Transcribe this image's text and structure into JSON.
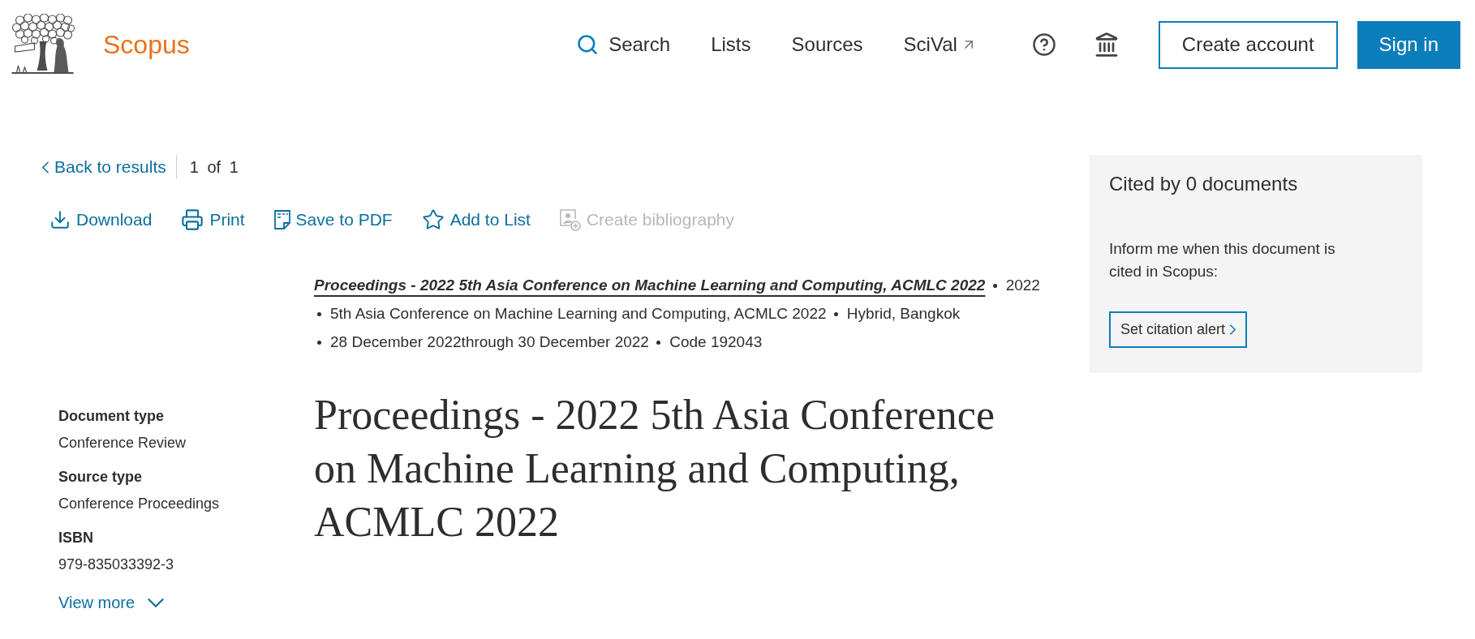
{
  "header": {
    "brand": "Scopus",
    "nav": [
      {
        "label": "Search",
        "kind": "search"
      },
      {
        "label": "Lists",
        "kind": "plain"
      },
      {
        "label": "Sources",
        "kind": "plain"
      },
      {
        "label": "SciVal",
        "kind": "external"
      }
    ],
    "buttons": [
      {
        "label": "Create account",
        "kind": "outline"
      },
      {
        "label": "Sign in",
        "kind": "primary"
      }
    ]
  },
  "pager": {
    "back": "Back to results",
    "position": "1 of 1"
  },
  "actions": [
    {
      "label": "Download",
      "kind": "download",
      "disabled": false
    },
    {
      "label": "Print",
      "kind": "print",
      "disabled": false
    },
    {
      "label": "Save to PDF",
      "kind": "pdf",
      "disabled": false
    },
    {
      "label": "Add to List",
      "kind": "list",
      "disabled": false
    },
    {
      "label": "Create bibliography",
      "kind": "bibliography",
      "disabled": true
    }
  ],
  "source": {
    "title": "Proceedings - 2022 5th Asia Conference on Machine Learning and Computing, ACMLC 2022",
    "details": [
      "2022",
      "5th Asia Conference on Machine Learning and Computing, ACMLC 2022",
      "Hybrid, Bangkok",
      "28 December 2022through 30 December 2022",
      "Code 192043"
    ]
  },
  "document": {
    "title": "Proceedings - 2022 5th Asia Conference on Machine Learning and Computing, ACMLC 2022"
  },
  "metadata": {
    "fields": [
      {
        "label": "Document type",
        "value": "Conference Review"
      },
      {
        "label": "Source type",
        "value": "Conference Proceedings"
      },
      {
        "label": "ISBN",
        "value": "979-835033392-3"
      }
    ],
    "view_more": "View more"
  },
  "citations": {
    "heading": "Cited by 0 documents",
    "text": "Inform me when this document is cited in Scopus:",
    "button": "Set citation alert"
  }
}
